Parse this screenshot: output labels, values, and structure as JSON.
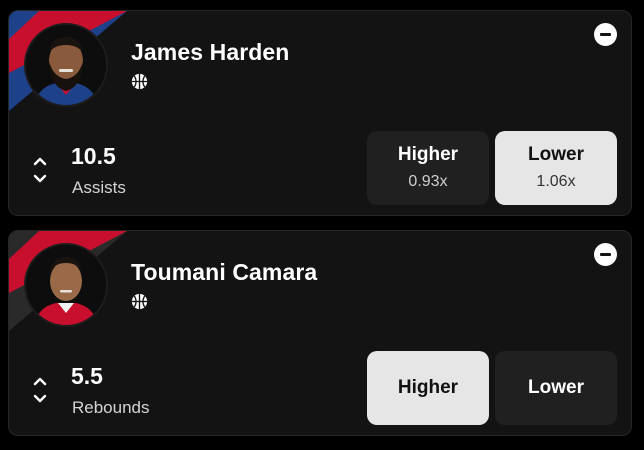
{
  "colors": {
    "card_bg": "#131313",
    "button_selected": "#e6e6e6",
    "button_unselected": "#202020",
    "stripe_red": "#c8102e",
    "stripe_blue": "#1d428a"
  },
  "picks": [
    {
      "player": "James Harden",
      "sport_icon": "basketball-icon",
      "line": "10.5",
      "stat": "Assists",
      "higher": {
        "label": "Higher",
        "multiplier": "0.93x"
      },
      "lower": {
        "label": "Lower",
        "multiplier": "1.06x"
      },
      "selected": "lower"
    },
    {
      "player": "Toumani Camara",
      "sport_icon": "basketball-icon",
      "line": "5.5",
      "stat": "Rebounds",
      "higher": {
        "label": "Higher"
      },
      "lower": {
        "label": "Lower"
      },
      "selected": "higher"
    }
  ]
}
